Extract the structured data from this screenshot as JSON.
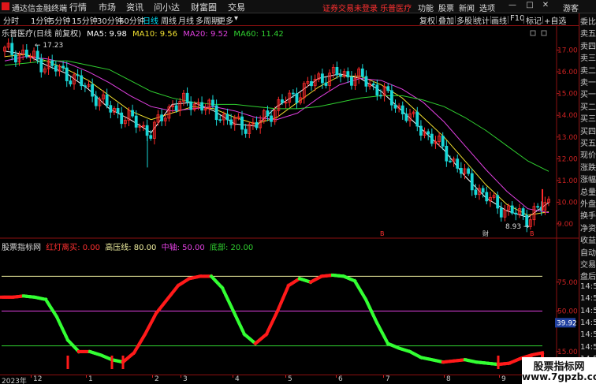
{
  "app": {
    "title": "通达信金融终端",
    "login_status": "证券交易未登录",
    "stock_name": "乐普医疗",
    "guest_label": "游客"
  },
  "menu": [
    "行情",
    "市场",
    "资讯",
    "问小达",
    "财富圈",
    "交易"
  ],
  "top_tools": [
    "功能",
    "股票",
    "新闻",
    "选项"
  ],
  "periods": [
    "分时",
    "1分钟",
    "5分钟",
    "15分钟",
    "30分钟",
    "60分钟",
    "日线",
    "周线",
    "月线",
    "多周期",
    "更多"
  ],
  "active_period": "日线",
  "right_tools": [
    "复权",
    "叠加",
    "多股",
    "统计",
    "画线",
    "F10",
    "标记",
    "+自选"
  ],
  "right_panel_labels": [
    "委比",
    "卖五",
    "卖四",
    "卖三",
    "卖二",
    "卖一",
    "买一",
    "买二",
    "买三",
    "买四",
    "买五",
    "现价",
    "涨跌",
    "涨幅",
    "总量",
    "外盘",
    "换手",
    "净资",
    "收益",
    "自动",
    "交易",
    "盘后",
    "14:50",
    "14:50",
    "14:50",
    "14:50",
    "14:50",
    "14:50",
    "14:51",
    "14:51"
  ],
  "main_chart": {
    "title": "乐普医疗(日线 前复权)",
    "ma": [
      {
        "label": "MA5: 9.98",
        "color": "#ffffff"
      },
      {
        "label": "MA10: 9.56",
        "color": "#f0e030"
      },
      {
        "label": "MA20: 9.52",
        "color": "#e040e0"
      },
      {
        "label": "MA60: 11.42",
        "color": "#30d030"
      }
    ],
    "high_label": "17.23",
    "low_label": "8.93",
    "event_marks": [
      "B",
      "财",
      "B"
    ],
    "y_ticks": [
      "17.00",
      "16.00",
      "15.00",
      "14.00",
      "13.00",
      "12.00",
      "11.00",
      "10.00",
      "9.00"
    ],
    "colors": {
      "up": "#ff2a2a",
      "down": "#19d7d7"
    }
  },
  "chart_data": [
    {
      "type": "line",
      "title": "乐普医疗(日线 前复权)",
      "ylim": [
        8.6,
        17.6
      ],
      "series": [
        {
          "name": "MA5",
          "values": [
            16.95,
            16.8,
            16.3,
            15.9,
            15.2,
            14.3,
            13.8,
            13.2,
            14.5,
            14.6,
            14.2,
            13.6,
            13.5,
            14.4,
            15.0,
            15.7,
            15.9,
            15.7,
            15.1,
            14.2,
            13.3,
            12.4,
            11.2,
            10.2,
            9.6,
            9.3,
            9.98
          ]
        },
        {
          "name": "MA10",
          "values": [
            16.7,
            16.8,
            16.5,
            16.1,
            15.6,
            14.9,
            14.2,
            13.8,
            14.1,
            14.4,
            14.3,
            13.9,
            13.6,
            13.9,
            14.6,
            15.3,
            15.8,
            15.8,
            15.4,
            14.8,
            13.9,
            13.0,
            11.9,
            10.8,
            9.9,
            9.4,
            9.56
          ]
        },
        {
          "name": "MA20",
          "values": [
            16.5,
            16.7,
            16.6,
            16.4,
            16.0,
            15.5,
            14.9,
            14.4,
            14.2,
            14.3,
            14.4,
            14.2,
            13.9,
            13.8,
            14.1,
            14.8,
            15.4,
            15.7,
            15.6,
            15.2,
            14.6,
            13.7,
            12.6,
            11.5,
            10.5,
            9.7,
            9.52
          ]
        },
        {
          "name": "MA60",
          "values": [
            16.3,
            16.4,
            16.5,
            16.5,
            16.3,
            16.1,
            15.6,
            15.1,
            14.8,
            14.6,
            14.5,
            14.5,
            14.4,
            14.3,
            14.3,
            14.4,
            14.6,
            14.8,
            14.9,
            14.9,
            14.7,
            14.4,
            13.9,
            13.3,
            12.6,
            11.9,
            11.42
          ]
        }
      ],
      "y_ticks": [
        17,
        16,
        15,
        14,
        13,
        12,
        11,
        10,
        9
      ]
    },
    {
      "type": "line",
      "title": "股票指标网",
      "ylim": [
        0,
        100
      ],
      "y_ticks": [
        75,
        50,
        15
      ],
      "levels": [
        {
          "name": "红灯离买",
          "value": 0,
          "label": "0.00",
          "color": "#ff3030"
        },
        {
          "name": "高压线",
          "value": 80,
          "label": "80.00",
          "color": "#f0f0a0"
        },
        {
          "name": "中轴",
          "value": 50,
          "label": "50.00",
          "color": "#e040e0"
        },
        {
          "name": "底部",
          "value": 20,
          "label": "20.00",
          "color": "#30d030"
        }
      ],
      "series": [
        {
          "name": "信号线",
          "values": [
            62,
            62,
            63,
            62,
            60,
            45,
            25,
            15,
            15,
            12,
            8,
            6,
            14,
            30,
            48,
            60,
            72,
            78,
            80,
            80,
            70,
            50,
            30,
            22,
            30,
            50,
            72,
            78,
            75,
            80,
            81,
            80,
            76,
            60,
            40,
            22,
            18,
            15,
            10,
            8,
            6,
            7,
            8,
            6,
            5,
            4,
            5,
            9,
            12,
            14
          ]
        }
      ],
      "current_value": "39.92",
      "buy_signals": [
        6,
        10,
        11,
        45,
        48
      ]
    }
  ],
  "x_axis": [
    "2023年",
    "12",
    "1",
    "2",
    "3",
    "4",
    "5",
    "6",
    "7",
    "8",
    "9"
  ],
  "watermark": {
    "line1": "股票指标网",
    "line2": "www.7gpzb.com"
  }
}
